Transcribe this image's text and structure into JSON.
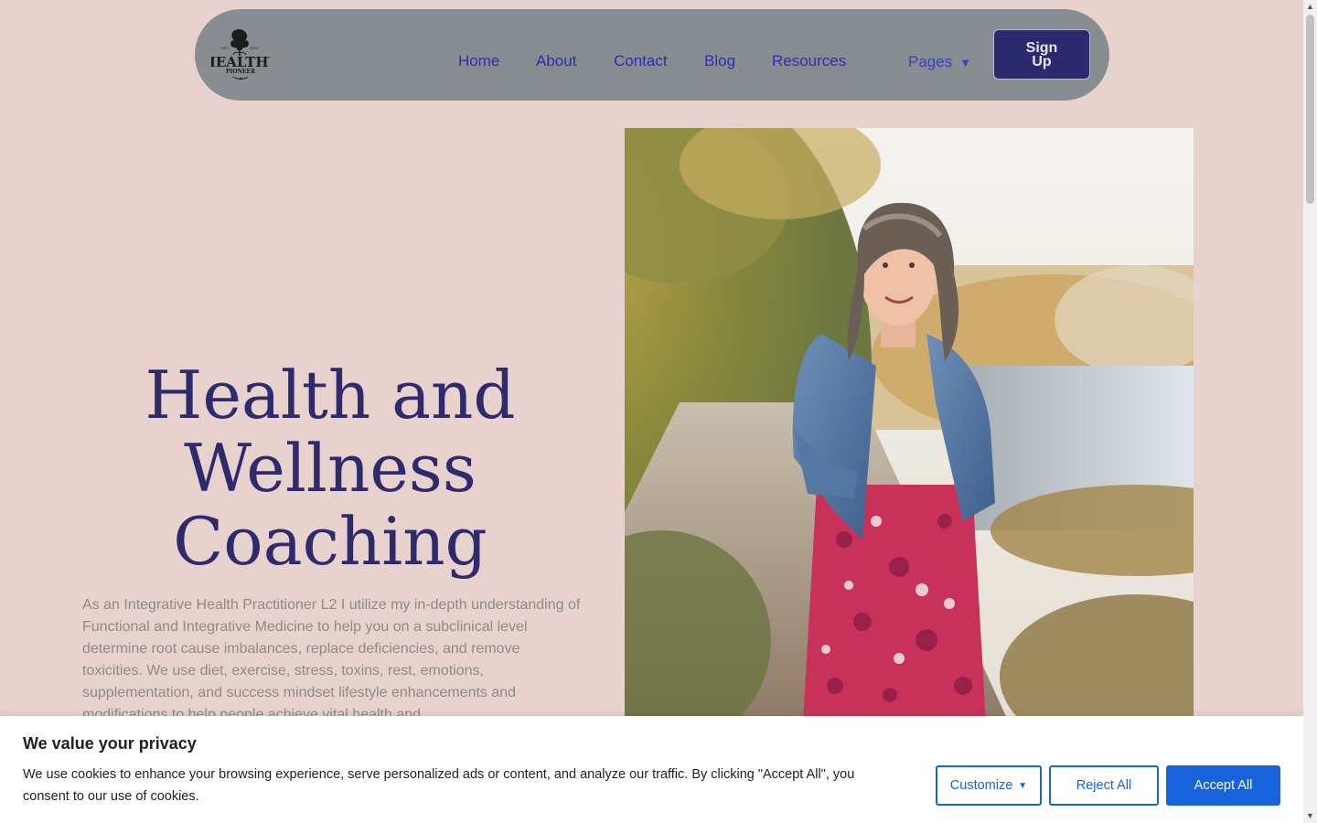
{
  "nav": {
    "logo": {
      "line1": "HEALTHY",
      "line2": "PIONEER",
      "est": "EST.",
      "year": "2023"
    },
    "links": [
      "Home",
      "About",
      "Contact",
      "Blog",
      "Resources"
    ],
    "pages_label": "Pages",
    "pages_caret": "▼",
    "signup_label": "Sign Up"
  },
  "hero": {
    "title_line1": "Health and",
    "title_line2": "Wellness",
    "title_line3": "Coaching",
    "description": "As an Integrative Health Practitioner L2 I utilize my in-depth understanding of Functional and Integrative Medicine to help you on a subclinical level determine root cause imbalances, replace deficiencies, and remove toxicities. We use diet, exercise, stress, toxins, rest, emotions, supplementation, and success mindset lifestyle enhancements and modifications to help people achieve vital health and"
  },
  "cookie": {
    "title": "We value your privacy",
    "text": "We use cookies to enhance your browsing experience, serve personalized ads or content, and analyze our traffic. By clicking \"Accept All\", you consent to our use of cookies.",
    "customize_label": "Customize",
    "reject_label": "Reject All",
    "accept_label": "Accept All",
    "accent_color": "#1863dc"
  },
  "colors": {
    "background": "#e8d2cd",
    "nav_bg": "#878d91",
    "link": "#2a2db5",
    "title": "#2f2a6b",
    "signup_bg": "#2c2a6e"
  }
}
